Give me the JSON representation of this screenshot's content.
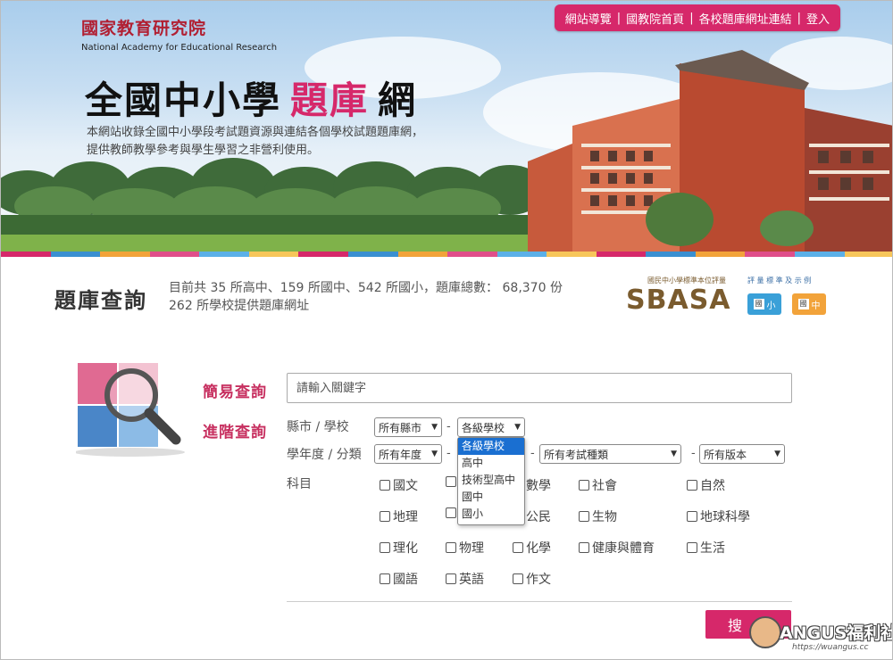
{
  "header": {
    "logo_cn": "國家教育研究院",
    "logo_en": "National Academy for Educational Research",
    "nav": [
      "網站導覽",
      "國教院首頁",
      "各校題庫網址連結",
      "登入"
    ],
    "nav_sep": "|",
    "title_pre": "全國中小學",
    "title_hl": "題庫",
    "title_post": "網",
    "desc_line1": "本網站收錄全國中小學段考試題資源與連結各個學校試題題庫網，",
    "desc_line2": "提供教師教學參考與學生學習之非營利使用。"
  },
  "stats": {
    "title": "題庫查詢",
    "line1": "目前共 35 所高中、159 所國中、542 所國小，題庫總數： 68,370 份",
    "line2": "262 所學校提供題庫網址"
  },
  "sbasa": {
    "logo": "SBASA",
    "small": "國民中小學標準本位評量",
    "right": "評 量 標 準 及 示 例",
    "badge_elem": "小",
    "badge_junior": "中",
    "badge_elem_char": "國",
    "badge_junior_char": "國"
  },
  "form": {
    "simple_label": "簡易查詢",
    "advanced_label": "進階查詢",
    "keyword_placeholder": "請輸入關鍵字",
    "row1_label": "縣市 / 學校",
    "county_value": "所有縣市",
    "school_level_value": "各級學校",
    "row2_label": "學年度 / 分類",
    "year_value": "所有年度",
    "exam_type_value": "所有考試種類",
    "version_value": "所有版本",
    "dash": "-",
    "subject_label": "科目",
    "dropdown_options": [
      "各級學校",
      "高中",
      "技術型高中",
      "國中",
      "國小"
    ],
    "subjects": [
      "國文",
      "數學",
      "社會",
      "自然",
      "地理",
      "公民",
      "生物",
      "地球科學",
      "理化",
      "物理",
      "化學",
      "健康與體育",
      "生活",
      "國語",
      "英語",
      "作文"
    ],
    "search_button": "搜尋"
  },
  "watermark": {
    "text": "ANGUS福利社",
    "url": "https://wuangus.cc"
  },
  "colors": {
    "accent": "#d6286a",
    "label": "#c73060",
    "stripe": [
      "#d6286a",
      "#3a8fd1",
      "#f2a33a",
      "#e04e8a",
      "#5bb0e8",
      "#f7c65a"
    ]
  }
}
